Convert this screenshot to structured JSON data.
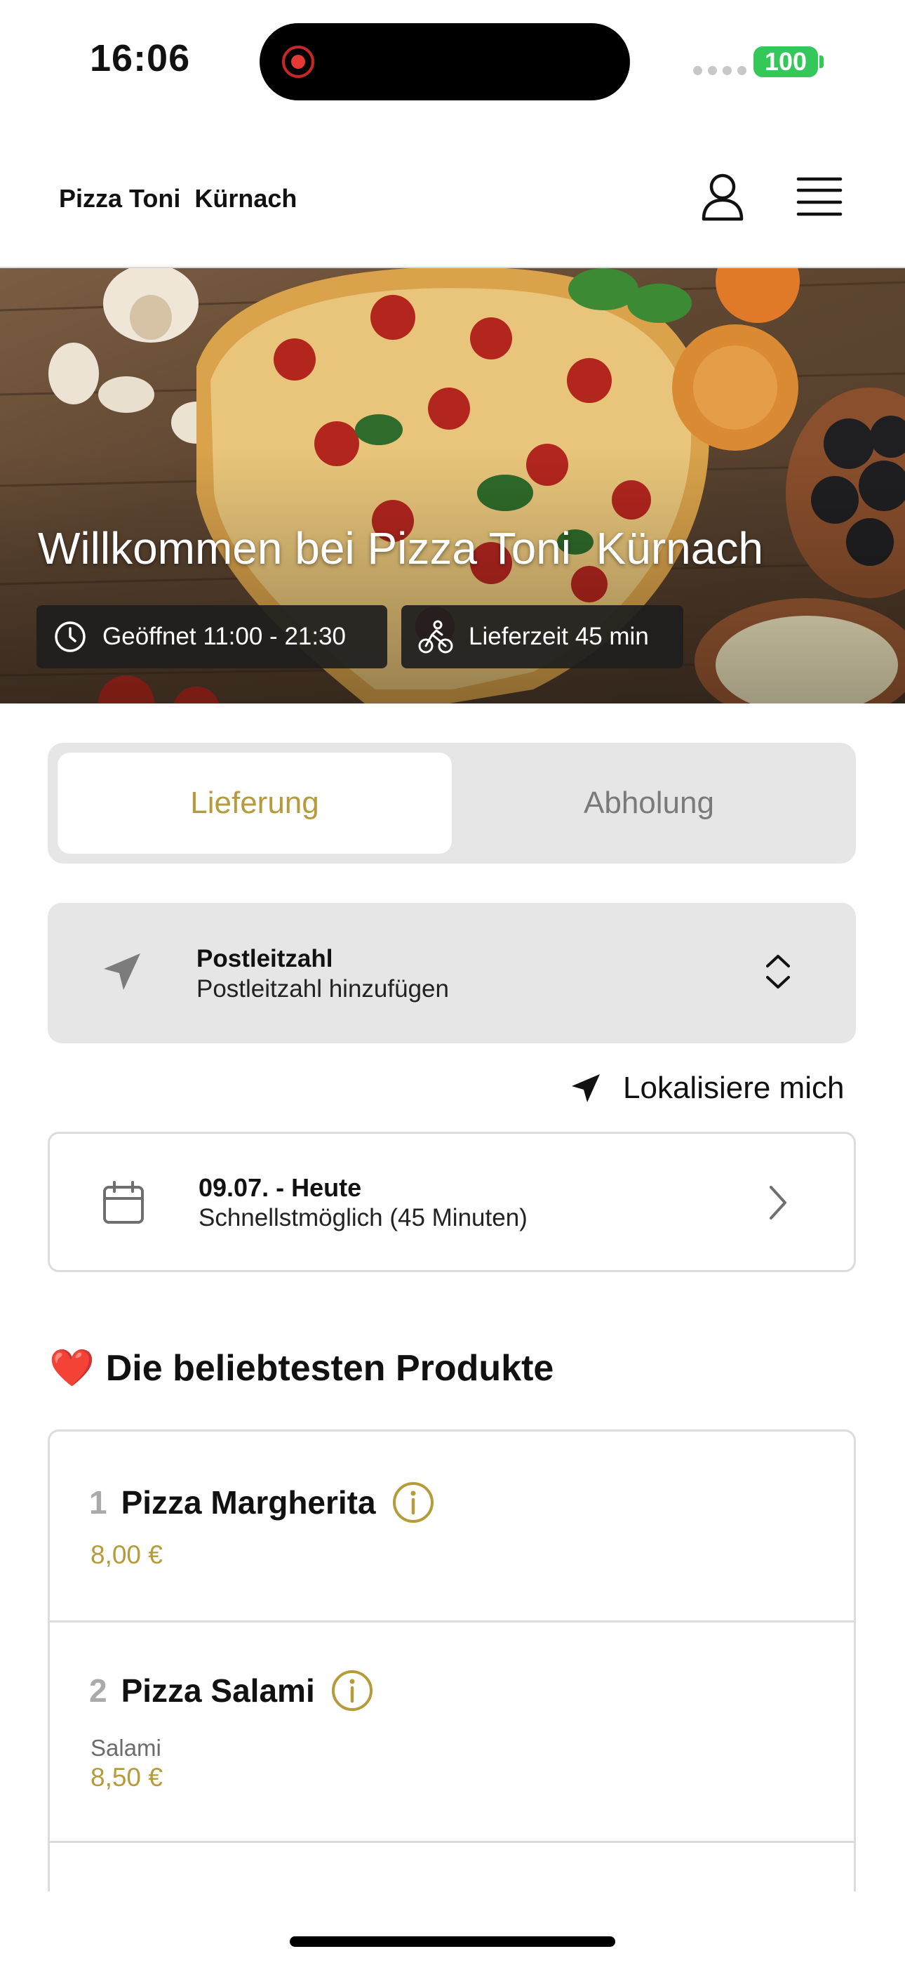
{
  "status_bar": {
    "time": "16:06",
    "battery": "100"
  },
  "header": {
    "brand": "Pizza Toni  Kürnach",
    "account_icon": "user-icon",
    "menu_icon": "hamburger-menu-icon"
  },
  "hero": {
    "title": "Willkommen bei Pizza Toni  Kürnach",
    "opening_hours": "Geöffnet 11:00 - 21:30",
    "delivery_time": "Lieferzeit 45 min",
    "image": "pizza-on-wooden-table-photo"
  },
  "mode_toggle": {
    "options": [
      "Lieferung",
      "Abholung"
    ],
    "selected": "Lieferung"
  },
  "postcode": {
    "label": "Postleitzahl",
    "placeholder": "Postleitzahl hinzufügen"
  },
  "locate": {
    "label": "Lokalisiere mich"
  },
  "schedule": {
    "date": "09.07. - Heute",
    "time": "Schnellstmöglich (45 Minuten)"
  },
  "popular": {
    "emoji": "❤️",
    "title": "Die beliebtesten Produkte",
    "products": [
      {
        "rank": "1",
        "name": "Pizza Margherita",
        "description": "",
        "price": "8,00 €"
      },
      {
        "rank": "2",
        "name": "Pizza Salami",
        "description": "Salami",
        "price": "8,50 €"
      }
    ]
  },
  "colors": {
    "accent": "#b59b3a",
    "battery": "#34c759",
    "card_grey": "#e6e6e6",
    "chip_dark": "#1e1e1e"
  }
}
